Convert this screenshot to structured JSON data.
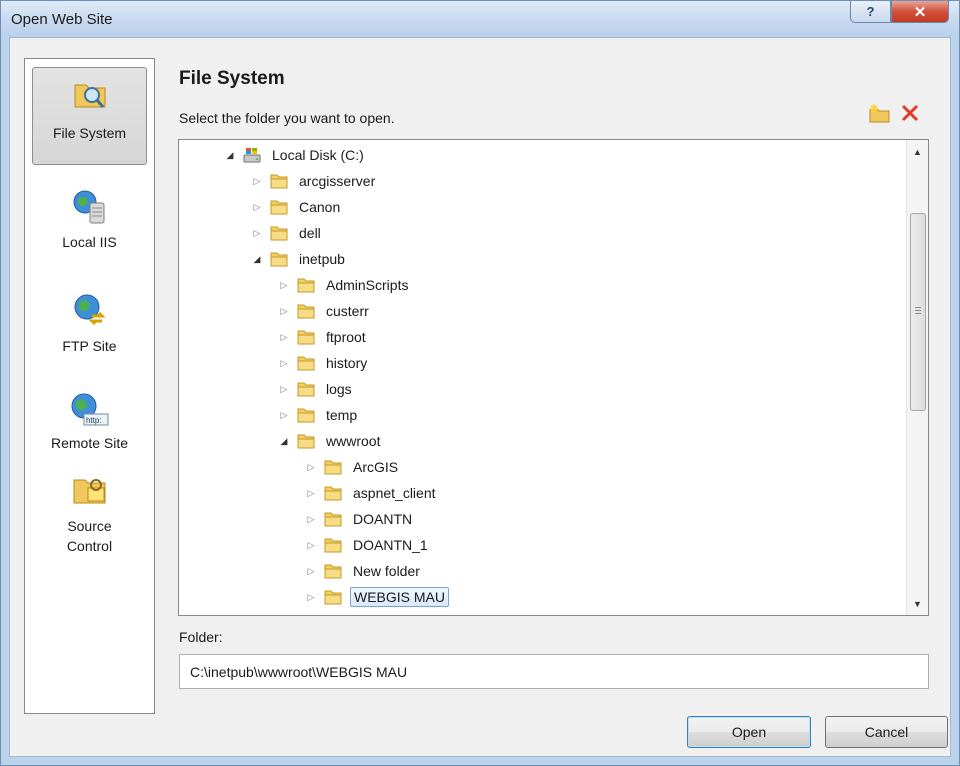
{
  "window": {
    "title": "Open Web Site"
  },
  "places": [
    {
      "label": "File System",
      "icon": "file-system-icon",
      "selected": true
    },
    {
      "label": "Local IIS",
      "icon": "local-iis-icon",
      "selected": false
    },
    {
      "label": "FTP Site",
      "icon": "ftp-site-icon",
      "selected": false
    },
    {
      "label": "Remote Site",
      "icon": "remote-site-icon",
      "selected": false
    },
    {
      "label": "Source Control",
      "icon": "source-control-icon",
      "selected": false
    }
  ],
  "main": {
    "heading": "File System",
    "instruction": "Select the folder you want to open."
  },
  "tree": {
    "items": [
      {
        "label": "Local Disk (C:)",
        "level": 0,
        "expanded": true,
        "type": "drive"
      },
      {
        "label": "arcgisserver",
        "level": 1,
        "expanded": false,
        "type": "folder"
      },
      {
        "label": "Canon",
        "level": 1,
        "expanded": false,
        "type": "folder"
      },
      {
        "label": "dell",
        "level": 1,
        "expanded": false,
        "type": "folder"
      },
      {
        "label": "inetpub",
        "level": 1,
        "expanded": true,
        "type": "folder"
      },
      {
        "label": "AdminScripts",
        "level": 2,
        "expanded": false,
        "type": "folder"
      },
      {
        "label": "custerr",
        "level": 2,
        "expanded": false,
        "type": "folder"
      },
      {
        "label": "ftproot",
        "level": 2,
        "expanded": false,
        "type": "folder"
      },
      {
        "label": "history",
        "level": 2,
        "expanded": false,
        "type": "folder"
      },
      {
        "label": "logs",
        "level": 2,
        "expanded": false,
        "type": "folder"
      },
      {
        "label": "temp",
        "level": 2,
        "expanded": false,
        "type": "folder"
      },
      {
        "label": "wwwroot",
        "level": 2,
        "expanded": true,
        "type": "folder"
      },
      {
        "label": "ArcGIS",
        "level": 3,
        "expanded": false,
        "type": "folder"
      },
      {
        "label": "aspnet_client",
        "level": 3,
        "expanded": false,
        "type": "folder"
      },
      {
        "label": "DOANTN",
        "level": 3,
        "expanded": false,
        "type": "folder"
      },
      {
        "label": "DOANTN_1",
        "level": 3,
        "expanded": false,
        "type": "folder"
      },
      {
        "label": "New folder",
        "level": 3,
        "expanded": false,
        "type": "folder"
      },
      {
        "label": "WEBGIS MAU",
        "level": 3,
        "expanded": false,
        "type": "folder",
        "selected": true
      }
    ]
  },
  "folder": {
    "label": "Folder:",
    "value": "C:\\inetpub\\wwwroot\\WEBGIS MAU"
  },
  "buttons": {
    "open": "Open",
    "cancel": "Cancel"
  },
  "colors": {
    "folder_yellow": "#f3cf5c",
    "selection_border": "#7da2ce",
    "delete_red": "#e23a2a"
  }
}
